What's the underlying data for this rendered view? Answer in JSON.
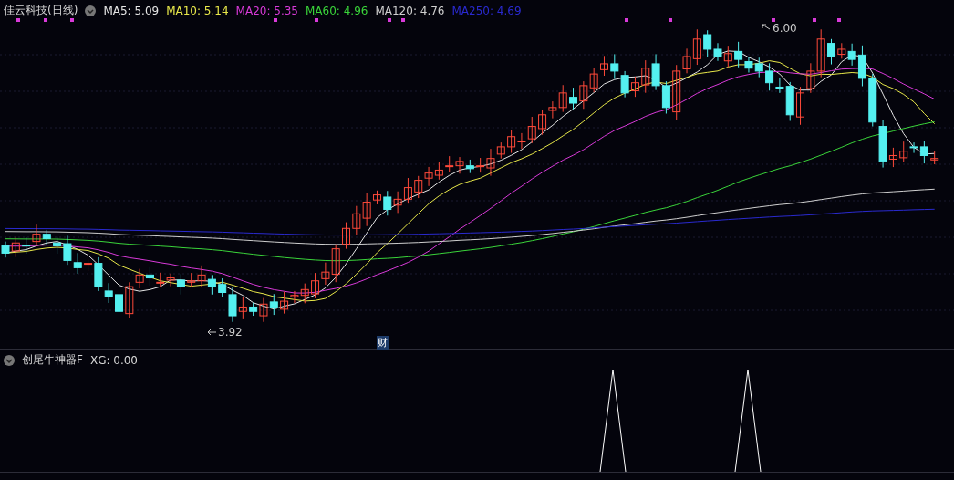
{
  "header": {
    "title": "佳云科技(日线)",
    "indicators": [
      {
        "text": "MA5: 5.09",
        "color": "#e6e6e6"
      },
      {
        "text": "MA10: 5.14",
        "color": "#e8e84a"
      },
      {
        "text": "MA20: 5.35",
        "color": "#d93ad9"
      },
      {
        "text": "MA60: 4.96",
        "color": "#3ad43a"
      },
      {
        "text": "MA120: 4.76",
        "color": "#cfcfcf"
      },
      {
        "text": "MA250: 4.69",
        "color": "#2a2ad0"
      }
    ]
  },
  "price_labels": [
    {
      "kind": "high",
      "text": "6.00"
    },
    {
      "kind": "low",
      "text": "3.92"
    }
  ],
  "event_marker": {
    "text": "财"
  },
  "sub_panel": {
    "title": "创尾牛神器F",
    "reading": "XG: 0.00"
  }
}
